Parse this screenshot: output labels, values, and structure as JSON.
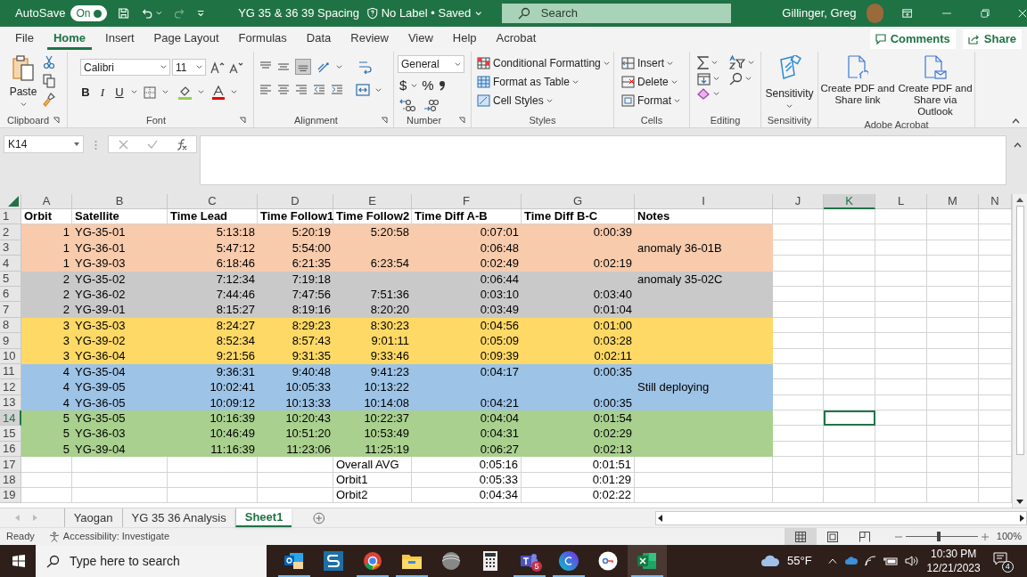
{
  "title_bar": {
    "autosave_label": "AutoSave",
    "autosave_toggle": {
      "label": "On",
      "on": true
    },
    "document_title": "YG 35 & 36 39 Spacing",
    "sensitivity_status": "No Label • Saved",
    "search_placeholder": "Search",
    "user_name": "Gillinger, Greg"
  },
  "menu_tabs": [
    {
      "label": "File",
      "selected": false
    },
    {
      "label": "Home",
      "selected": true
    },
    {
      "label": "Insert",
      "selected": false
    },
    {
      "label": "Page Layout",
      "selected": false
    },
    {
      "label": "Formulas",
      "selected": false
    },
    {
      "label": "Data",
      "selected": false
    },
    {
      "label": "Review",
      "selected": false
    },
    {
      "label": "View",
      "selected": false
    },
    {
      "label": "Help",
      "selected": false
    },
    {
      "label": "Acrobat",
      "selected": false
    }
  ],
  "comments_button": "Comments",
  "share_button": "Share",
  "ribbon": {
    "clipboard": {
      "paste": "Paste",
      "label": "Clipboard"
    },
    "font": {
      "name": "Calibri",
      "size": "11",
      "bold": "B",
      "italic": "I",
      "underline": "U",
      "label": "Font"
    },
    "alignment": {
      "label": "Alignment"
    },
    "number": {
      "format": "General",
      "currency": "$",
      "percent": "%",
      "label": "Number"
    },
    "styles": {
      "items": [
        "Conditional Formatting",
        "Format as Table",
        "Cell Styles"
      ],
      "label": "Styles"
    },
    "cells": {
      "items": [
        "Insert",
        "Delete",
        "Format"
      ],
      "label": "Cells"
    },
    "editing": {
      "label": "Editing"
    },
    "sensitivity": {
      "button": "Sensitivity",
      "label": "Sensitivity"
    },
    "acrobat": {
      "buttons": [
        "Create PDF and Share link",
        "Create PDF and Share via Outlook"
      ],
      "label": "Adobe Acrobat"
    }
  },
  "name_box": "K14",
  "columns": [
    {
      "label": "A",
      "selected": false
    },
    {
      "label": "B",
      "selected": false
    },
    {
      "label": "C",
      "selected": false
    },
    {
      "label": "D",
      "selected": false
    },
    {
      "label": "E",
      "selected": false
    },
    {
      "label": "F",
      "selected": false
    },
    {
      "label": "G",
      "selected": false
    },
    {
      "label": "I",
      "selected": false
    },
    {
      "label": "J",
      "selected": false
    },
    {
      "label": "K",
      "selected": true
    },
    {
      "label": "L",
      "selected": false
    },
    {
      "label": "M",
      "selected": false
    },
    {
      "label": "N",
      "selected": false
    }
  ],
  "rows": [
    {
      "number": "1",
      "kind": "header",
      "selected": false,
      "cells": {
        "a": "Orbit",
        "b": "Satellite",
        "c": "Time Lead",
        "d": "Time Follow1",
        "e": "Time Follow2",
        "f": "Time Diff A-B",
        "g": "Time Diff B-C",
        "i": "Notes"
      }
    },
    {
      "number": "2",
      "kind": "data",
      "selected": false,
      "color": "#f8cbad",
      "cells": {
        "a": "1",
        "b": "YG-35-01",
        "c": "5:13:18",
        "d": "5:20:19",
        "e": "5:20:58",
        "f": "0:07:01",
        "g": "0:00:39"
      }
    },
    {
      "number": "3",
      "kind": "data",
      "selected": false,
      "color": "#f8cbad",
      "cells": {
        "a": "1",
        "b": "YG-36-01",
        "c": "5:47:12",
        "d": "5:54:00",
        "f": "0:06:48",
        "i": "anomaly 36-01B"
      }
    },
    {
      "number": "4",
      "kind": "data",
      "selected": false,
      "color": "#f8cbad",
      "cells": {
        "a": "1",
        "b": "YG-39-03",
        "c": "6:18:46",
        "d": "6:21:35",
        "e": "6:23:54",
        "f": "0:02:49",
        "g": "0:02:19"
      }
    },
    {
      "number": "5",
      "kind": "data",
      "selected": false,
      "color": "#c9c9c9",
      "cells": {
        "a": "2",
        "b": "YG-35-02",
        "c": "7:12:34",
        "d": "7:19:18",
        "f": "0:06:44",
        "i": "anomaly 35-02C"
      }
    },
    {
      "number": "6",
      "kind": "data",
      "selected": false,
      "color": "#c9c9c9",
      "cells": {
        "a": "2",
        "b": "YG-36-02",
        "c": "7:44:46",
        "d": "7:47:56",
        "e": "7:51:36",
        "f": "0:03:10",
        "g": "0:03:40"
      }
    },
    {
      "number": "7",
      "kind": "data",
      "selected": false,
      "color": "#c9c9c9",
      "cells": {
        "a": "2",
        "b": "YG-39-01",
        "c": "8:15:27",
        "d": "8:19:16",
        "e": "8:20:20",
        "f": "0:03:49",
        "g": "0:01:04"
      }
    },
    {
      "number": "8",
      "kind": "data",
      "selected": false,
      "color": "#ffd966",
      "cells": {
        "a": "3",
        "b": "YG-35-03",
        "c": "8:24:27",
        "d": "8:29:23",
        "e": "8:30:23",
        "f": "0:04:56",
        "g": "0:01:00"
      }
    },
    {
      "number": "9",
      "kind": "data",
      "selected": false,
      "color": "#ffd966",
      "cells": {
        "a": "3",
        "b": "YG-39-02",
        "c": "8:52:34",
        "d": "8:57:43",
        "e": "9:01:11",
        "f": "0:05:09",
        "g": "0:03:28"
      }
    },
    {
      "number": "10",
      "kind": "data",
      "selected": false,
      "color": "#ffd966",
      "cells": {
        "a": "3",
        "b": "YG-36-04",
        "c": "9:21:56",
        "d": "9:31:35",
        "e": "9:33:46",
        "f": "0:09:39",
        "g": "0:02:11"
      }
    },
    {
      "number": "11",
      "kind": "data",
      "selected": false,
      "color": "#9dc3e6",
      "cells": {
        "a": "4",
        "b": "YG-35-04",
        "c": "9:36:31",
        "d": "9:40:48",
        "e": "9:41:23",
        "f": "0:04:17",
        "g": "0:00:35"
      }
    },
    {
      "number": "12",
      "kind": "data",
      "selected": false,
      "color": "#9dc3e6",
      "cells": {
        "a": "4",
        "b": "YG-39-05",
        "c": "10:02:41",
        "d": "10:05:33",
        "e": "10:13:22",
        "i": "Still deploying"
      }
    },
    {
      "number": "13",
      "kind": "data",
      "selected": false,
      "color": "#9dc3e6",
      "cells": {
        "a": "4",
        "b": "YG-36-05",
        "c": "10:09:12",
        "d": "10:13:33",
        "e": "10:14:08",
        "f": "0:04:21",
        "g": "0:00:35"
      }
    },
    {
      "number": "14",
      "kind": "data",
      "selected": true,
      "color": "#a9d08e",
      "cells": {
        "a": "5",
        "b": "YG-35-05",
        "c": "10:16:39",
        "d": "10:20:43",
        "e": "10:22:37",
        "f": "0:04:04",
        "g": "0:01:54"
      }
    },
    {
      "number": "15",
      "kind": "data",
      "selected": false,
      "color": "#a9d08e",
      "cells": {
        "a": "5",
        "b": "YG-36-03",
        "c": "10:46:49",
        "d": "10:51:20",
        "e": "10:53:49",
        "f": "0:04:31",
        "g": "0:02:29"
      }
    },
    {
      "number": "16",
      "kind": "data",
      "selected": false,
      "color": "#a9d08e",
      "cells": {
        "a": "5",
        "b": "YG-39-04",
        "c": "11:16:39",
        "d": "11:23:06",
        "e": "11:25:19",
        "f": "0:06:27",
        "g": "0:02:13"
      }
    },
    {
      "number": "17",
      "kind": "summary",
      "selected": false,
      "cells": {
        "e": "Overall AVG",
        "f": "0:05:16",
        "g": "0:01:51"
      }
    },
    {
      "number": "18",
      "kind": "summary",
      "selected": false,
      "cells": {
        "e": "Orbit1",
        "f": "0:05:33",
        "g": "0:01:29"
      }
    },
    {
      "number": "19",
      "kind": "summary",
      "selected": false,
      "cells": {
        "e": "Orbit2",
        "f": "0:04:34",
        "g": "0:02:22"
      }
    }
  ],
  "sheet_tabs": [
    {
      "label": "Yaogan",
      "selected": false
    },
    {
      "label": "YG 35 36 Analysis",
      "selected": false
    },
    {
      "label": "Sheet1",
      "selected": true
    }
  ],
  "status_bar": {
    "mode": "Ready",
    "accessibility": "Accessibility: Investigate",
    "view_buttons": [
      {
        "kind": "normal",
        "selected": true
      },
      {
        "kind": "page_layout",
        "selected": false
      },
      {
        "kind": "page_break",
        "selected": false
      }
    ],
    "zoom": {
      "level": 0.46,
      "reading": "100%"
    }
  },
  "taskbar": {
    "search_placeholder": "Type here to search",
    "apps": [
      {
        "kind": "mail",
        "running": true,
        "active": false
      },
      {
        "kind": "s-logo",
        "running": false,
        "active": false
      },
      {
        "kind": "browser",
        "running": true,
        "active": false
      },
      {
        "kind": "folder",
        "running": true,
        "active": false
      },
      {
        "kind": "globe",
        "running": false,
        "active": false
      },
      {
        "kind": "calculator",
        "running": false,
        "active": false
      },
      {
        "kind": "chat",
        "running": true,
        "active": false,
        "badge": "5"
      },
      {
        "kind": "design",
        "running": true,
        "active": false
      },
      {
        "kind": "key",
        "running": false,
        "active": false
      },
      {
        "kind": "sheet",
        "running": true,
        "active": true
      }
    ],
    "weather": "55°F",
    "time": "10:30 PM",
    "date": "12/21/2023",
    "notifications": "4"
  }
}
